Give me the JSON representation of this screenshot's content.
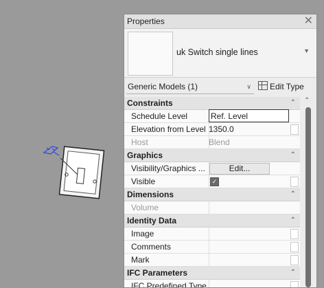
{
  "properties": {
    "title": "Properties",
    "close_icon": "close-icon",
    "type_name": "uk Switch single lines",
    "filter_label": "Generic Models (1)",
    "edit_type_label": "Edit Type"
  },
  "groups": {
    "constraints": {
      "label": "Constraints",
      "rows": {
        "schedule_level": {
          "label": "Schedule Level",
          "value": "Ref. Level"
        },
        "elevation": {
          "label": "Elevation from Level",
          "value": "1350.0"
        },
        "host": {
          "label": "Host",
          "value": "Blend"
        }
      }
    },
    "graphics": {
      "label": "Graphics",
      "rows": {
        "vis_overrides": {
          "label": "Visibility/Graphics ...",
          "button": "Edit..."
        },
        "visible": {
          "label": "Visible",
          "checked": true
        }
      }
    },
    "dimensions": {
      "label": "Dimensions",
      "rows": {
        "volume": {
          "label": "Volume",
          "value": ""
        }
      }
    },
    "identity": {
      "label": "Identity Data",
      "rows": {
        "image": {
          "label": "Image",
          "value": ""
        },
        "comments": {
          "label": "Comments",
          "value": ""
        },
        "mark": {
          "label": "Mark",
          "value": ""
        }
      }
    },
    "ifc": {
      "label": "IFC Parameters",
      "rows": {
        "ifc_type": {
          "label": "IFC Predefined Type",
          "value": ""
        }
      }
    }
  },
  "colors": {
    "canvas": "#9a9a9a",
    "palette": "#ececec",
    "highlight": "#1f4fa8"
  }
}
